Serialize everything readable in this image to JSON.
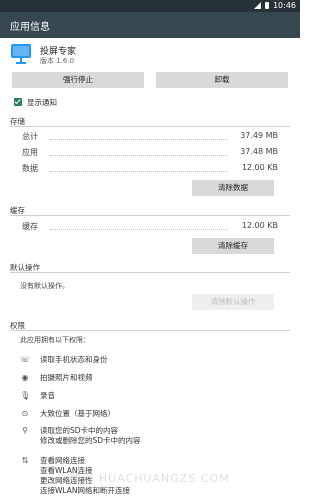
{
  "status_bar": {
    "time": "10:46"
  },
  "app_bar": {
    "title": "应用信息"
  },
  "app": {
    "name": "投屏专家",
    "version": "版本 1.6.0"
  },
  "buttons": {
    "force_stop": "强行停止",
    "uninstall": "卸载",
    "clear_data": "清除数据",
    "clear_cache": "清除缓存",
    "clear_defaults": "清除默认操作"
  },
  "notifications": {
    "label": "显示通知",
    "checked": true
  },
  "storage": {
    "title": "存储",
    "rows": [
      {
        "label": "总计",
        "value": "37.49 MB"
      },
      {
        "label": "应用",
        "value": "37.48 MB"
      },
      {
        "label": "数据",
        "value": "12.00 KB"
      }
    ]
  },
  "cache": {
    "title": "缓存",
    "rows": [
      {
        "label": "缓存",
        "value": "12.00 KB"
      }
    ]
  },
  "defaults": {
    "title": "默认操作",
    "text": "没有默认操作。"
  },
  "permissions": {
    "title": "权限",
    "intro": "此应用拥有以下权限：",
    "items": [
      {
        "icon": "phone-icon",
        "lines": [
          "读取手机状态和身份"
        ]
      },
      {
        "icon": "camera-icon",
        "lines": [
          "拍摄照片和视频"
        ]
      },
      {
        "icon": "microphone-icon",
        "lines": [
          "录音"
        ]
      },
      {
        "icon": "location-icon",
        "lines": [
          "大致位置（基于网络）"
        ]
      },
      {
        "icon": "usb-icon",
        "lines": [
          "读取您的SD卡中的内容",
          "修改或删除您的SD卡中的内容"
        ]
      },
      {
        "icon": "wifi-icon",
        "lines": [
          "查看网络连接",
          "查看WLAN连接",
          "更改网络连接性",
          "连接WLAN网络和断开连接"
        ]
      }
    ]
  },
  "watermark": "华创 HUACHUANGZS.COM"
}
